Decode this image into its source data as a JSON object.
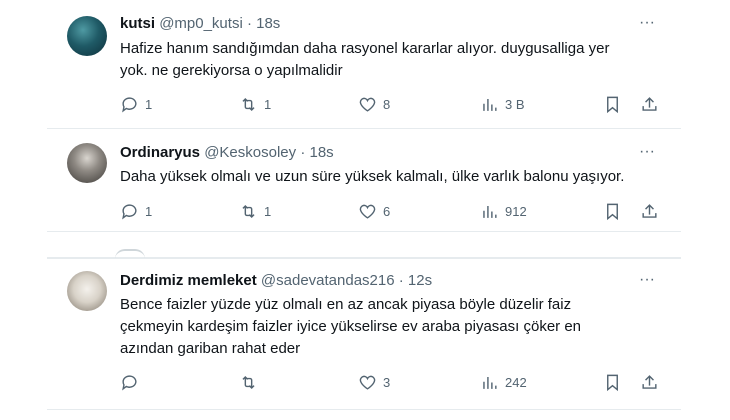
{
  "tweets": [
    {
      "name": "kutsi",
      "handle": "@mp0_kutsi",
      "time": "18s",
      "lines": [
        "Hafize hanım sandığımdan daha rasyonel kararlar alıyor. duygusalliga yer",
        "yok. ne gerekiyorsa o yapılmalidir"
      ],
      "replies": "1",
      "reposts": "1",
      "likes": "8",
      "views": "3 B"
    },
    {
      "name": "Ordinaryus",
      "handle": "@Keskosoley",
      "time": "18s",
      "lines": [
        "Daha yüksek olmalı ve uzun süre yüksek kalmalı, ülke varlık balonu yaşıyor."
      ],
      "replies": "1",
      "reposts": "1",
      "likes": "6",
      "views": "912"
    },
    {
      "name": "Derdimiz memleket",
      "handle": "@sadevatandas216",
      "time": "12s",
      "lines": [
        "Bence faizler yüzde yüz olmalı en az ancak piyasa böyle düzelir faiz",
        "çekmeyin kardeşim faizler iyice yükselirse ev araba piyasası çöker en",
        "azından gariban rahat eder"
      ],
      "replies": "",
      "reposts": "",
      "likes": "3",
      "views": "242"
    }
  ],
  "separator": "·",
  "more_glyph": "···",
  "icons": {
    "reply": "reply-icon",
    "repost": "repost-icon",
    "like": "heart-icon",
    "views": "views-icon",
    "bookmark": "bookmark-icon",
    "share": "share-icon"
  },
  "colors": {
    "text": "#0f1419",
    "muted": "#536471",
    "divider": "#e6ebee"
  }
}
